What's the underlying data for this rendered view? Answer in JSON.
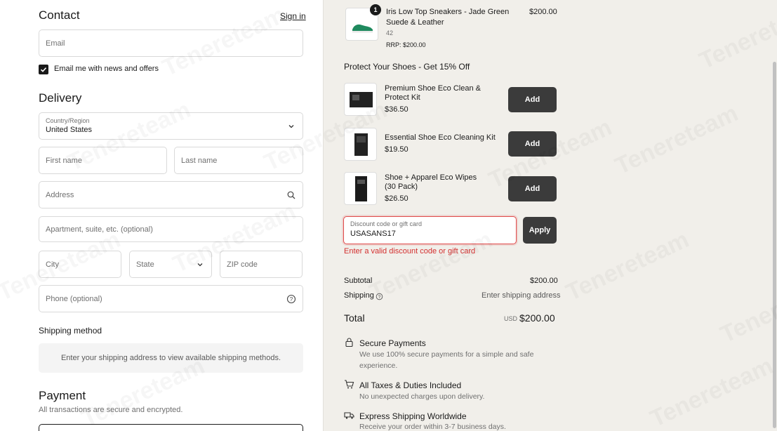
{
  "contact": {
    "title": "Contact",
    "sign_in": "Sign in",
    "email_placeholder": "Email",
    "newsletter_label": "Email me with news and offers",
    "newsletter_checked": true
  },
  "delivery": {
    "title": "Delivery",
    "country_label": "Country/Region",
    "country_value": "United States",
    "first_name": "First name",
    "last_name": "Last name",
    "address": "Address",
    "apartment": "Apartment, suite, etc. (optional)",
    "city": "City",
    "state": "State",
    "zip": "ZIP code",
    "phone": "Phone (optional)"
  },
  "shipping": {
    "title": "Shipping method",
    "message": "Enter your shipping address to view available shipping methods."
  },
  "payment": {
    "title": "Payment",
    "subtitle": "All transactions are secure and encrypted."
  },
  "cart_item": {
    "quantity": "1",
    "name_line1": "Iris Low Top Sneakers - Jade Green",
    "name_line2": "Suede & Leather",
    "size": "42",
    "rrp": "RRP: $200.00",
    "price": "$200.00"
  },
  "upsell": {
    "title": "Protect Your Shoes - Get 15% Off",
    "add_label": "Add",
    "items": [
      {
        "name_line1": "Premium Shoe Eco Clean &",
        "name_line2": "Protect Kit",
        "price": "$36.50"
      },
      {
        "name_line1": "Essential Shoe Eco Cleaning Kit",
        "name_line2": "",
        "price": "$19.50"
      },
      {
        "name_line1": "Shoe + Apparel Eco Wipes",
        "name_line2": "(30 Pack)",
        "price": "$26.50"
      }
    ]
  },
  "discount": {
    "label": "Discount code or gift card",
    "value": "USASANS17",
    "apply_label": "Apply",
    "error": "Enter a valid discount code or gift card"
  },
  "totals": {
    "subtotal_label": "Subtotal",
    "subtotal_value": "$200.00",
    "shipping_label": "Shipping",
    "shipping_value": "Enter shipping address",
    "total_label": "Total",
    "currency": "USD",
    "total_value": "$200.00"
  },
  "features": [
    {
      "icon": "lock-icon",
      "title": "Secure Payments",
      "desc": "We use 100% secure payments for a simple and safe experience."
    },
    {
      "icon": "cart-icon",
      "title": "All Taxes & Duties Included",
      "desc": "No unexpected charges upon delivery."
    },
    {
      "icon": "truck-icon",
      "title": "Express Shipping Worldwide",
      "desc": "Receive your order within 3-7 business days."
    }
  ],
  "watermark": "Tenereteam",
  "colors": {
    "accent": "#3b3b3b",
    "error": "#d32f2f",
    "right_bg": "#f1efea"
  }
}
